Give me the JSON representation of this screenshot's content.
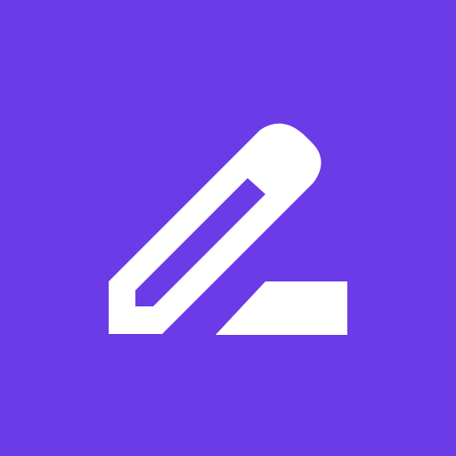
{
  "icon": {
    "name": "pencil-edit-icon",
    "background_color": "#6A3BE6",
    "glyph_color": "#FFFFFF"
  }
}
